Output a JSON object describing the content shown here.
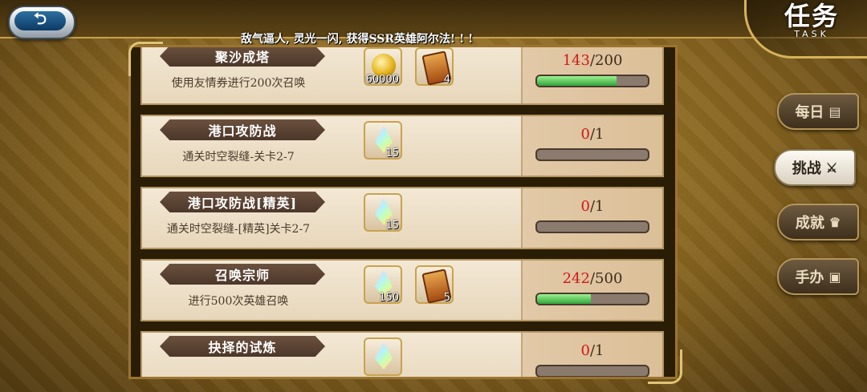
{
  "header": {
    "back_label": "⮌",
    "title": "任务",
    "title_sub": "TASK"
  },
  "marquee": "敌气逼人, 灵光一闪, 获得SSR英雄阿尔法! ! !",
  "tasks": [
    {
      "name": "聚沙成塔",
      "desc": "使用友情券进行200次召唤",
      "rewards": [
        {
          "icon": "coin-icon",
          "count": "60000"
        },
        {
          "icon": "ticket-icon",
          "count": "4"
        }
      ],
      "progress_current": "143",
      "progress_total": "/200",
      "progress_fraction": 0.715
    },
    {
      "name": "港口攻防战",
      "desc": "通关时空裂缝-关卡2-7",
      "rewards": [
        {
          "icon": "crystal-icon",
          "count": "15"
        }
      ],
      "progress_current": "0",
      "progress_total": "/1",
      "progress_fraction": 0
    },
    {
      "name": "港口攻防战[精英]",
      "desc": "通关时空裂缝-[精英]关卡2-7",
      "rewards": [
        {
          "icon": "crystal-icon",
          "count": "15"
        }
      ],
      "progress_current": "0",
      "progress_total": "/1",
      "progress_fraction": 0
    },
    {
      "name": "召唤宗师",
      "desc": "进行500次英雄召唤",
      "rewards": [
        {
          "icon": "crystal-icon",
          "count": "150"
        },
        {
          "icon": "ticket-icon",
          "count": "5"
        }
      ],
      "progress_current": "242",
      "progress_total": "/500",
      "progress_fraction": 0.484
    },
    {
      "name": "抉择的试炼",
      "desc": "",
      "rewards": [
        {
          "icon": "crystal-icon",
          "count": ""
        }
      ],
      "progress_current": "0",
      "progress_total": "/1",
      "progress_fraction": 0
    }
  ],
  "side_tabs": [
    {
      "label": "每日",
      "icon": "scroll-icon",
      "glyph": "▤",
      "active": false
    },
    {
      "label": "挑战",
      "icon": "crossed-swords-icon",
      "glyph": "⚔",
      "active": true
    },
    {
      "label": "成就",
      "icon": "trophy-icon",
      "glyph": "♛",
      "active": false
    },
    {
      "label": "手办",
      "icon": "figure-icon",
      "glyph": "▣",
      "active": false
    }
  ]
}
